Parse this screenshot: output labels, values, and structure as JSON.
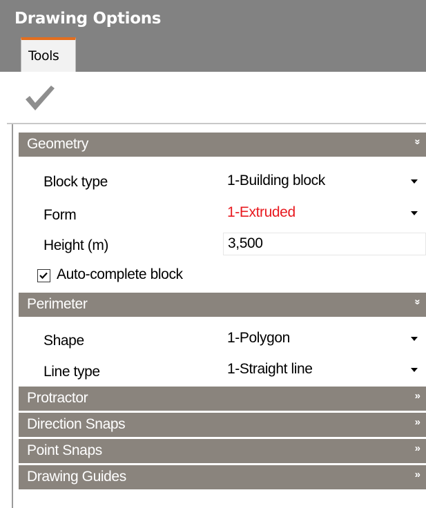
{
  "window": {
    "title": "Drawing Options"
  },
  "tabs": [
    {
      "label": "Tools",
      "active": true
    }
  ],
  "toolbar": {
    "apply_icon": "checkmark-icon"
  },
  "colors": {
    "section_header": "#8a847d",
    "accent_tab": "#e46e1e",
    "warning_value": "#e8191f"
  },
  "sections": {
    "geometry": {
      "label": "Geometry",
      "expanded": true,
      "block_type": {
        "label": "Block type",
        "value": "1-Building block"
      },
      "form": {
        "label": "Form",
        "value": "1-Extruded"
      },
      "height": {
        "label": "Height (m)",
        "value": "3,500"
      },
      "auto_complete": {
        "label": "Auto-complete block",
        "checked": true
      }
    },
    "perimeter": {
      "label": "Perimeter",
      "expanded": true,
      "shape": {
        "label": "Shape",
        "value": "1-Polygon"
      },
      "line_type": {
        "label": "Line type",
        "value": "1-Straight line"
      }
    },
    "protractor": {
      "label": "Protractor",
      "expanded": false
    },
    "direction_snaps": {
      "label": "Direction Snaps",
      "expanded": false
    },
    "point_snaps": {
      "label": "Point Snaps",
      "expanded": false
    },
    "drawing_guides": {
      "label": "Drawing Guides",
      "expanded": false
    }
  }
}
